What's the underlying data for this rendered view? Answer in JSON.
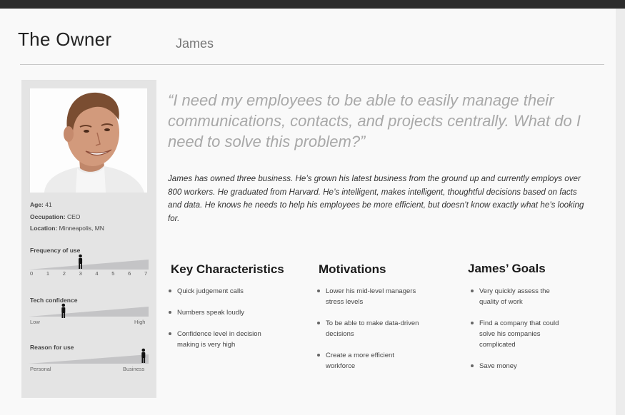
{
  "header": {
    "title": "The Owner",
    "name": "James"
  },
  "profile": {
    "facts": [
      {
        "label": "Age:",
        "value": "41"
      },
      {
        "label": "Occupation:",
        "value": "CEO"
      },
      {
        "label": "Location:",
        "value": "Minneapolis, MN"
      }
    ],
    "frequency": {
      "label": "Frequency of use",
      "ticks": [
        "0",
        "1",
        "2",
        "3",
        "4",
        "5",
        "6",
        "7"
      ],
      "value": 3,
      "max": 7
    },
    "tech_confidence": {
      "label": "Tech confidence",
      "low": "Low",
      "high": "High",
      "level": 0.28
    },
    "reason": {
      "label": "Reason for use",
      "left": "Personal",
      "right": "Business",
      "level": 0.98
    }
  },
  "quote": "“I need my employees to be able to easily manage their communications, contacts, and projects centrally. What do I need to solve this problem?”",
  "bio": "James has owned three business. He’s grown his latest business from the ground up and currently employs over 800 workers. He graduated from Harvard. He’s intelligent, makes intelligent, thoughtful decisions based on facts and data. He knows he needs to help his employees be more efficient, but doesn’t know exactly what he’s looking for.",
  "columns": {
    "characteristics": {
      "title": "Key Characteristics",
      "items": [
        "Quick judgement calls",
        "Numbers speak loudly",
        "Confidence level in decision making is very high"
      ]
    },
    "motivations": {
      "title": "Motivations",
      "items": [
        "Lower his mid-level managers stress levels",
        "To be able to make data-driven decisions",
        "Create a more efficient workforce"
      ]
    },
    "goals": {
      "title": "James’ Goals",
      "items": [
        "Very quickly assess the quality of work",
        "Find a company that could solve his companies complicated",
        "Save money"
      ]
    }
  }
}
